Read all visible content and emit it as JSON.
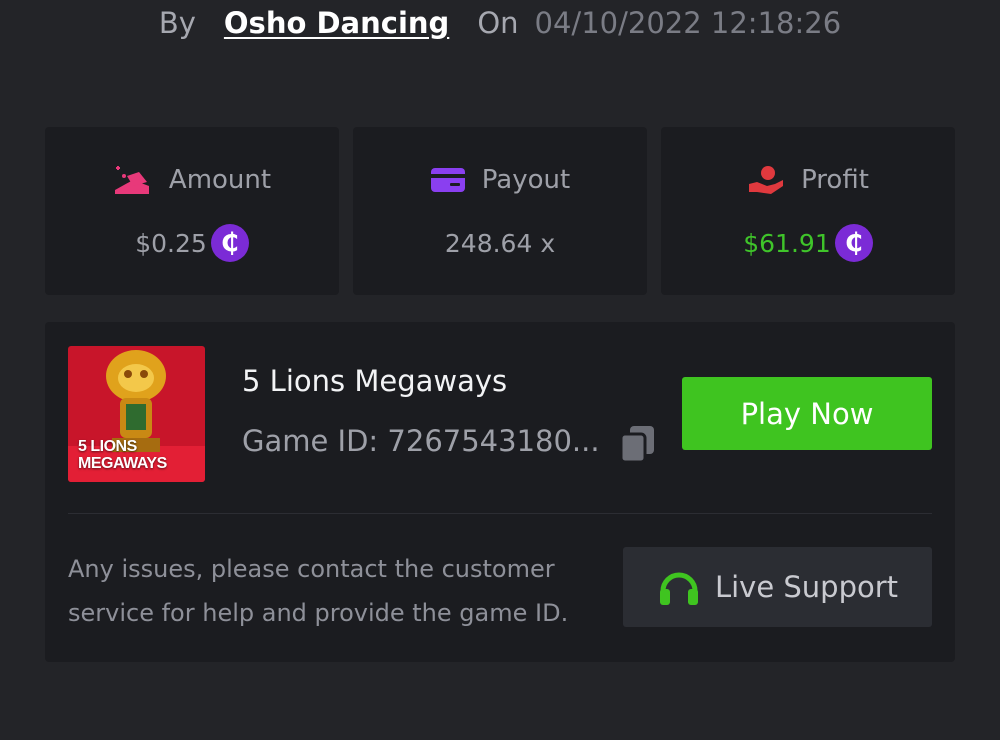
{
  "byline": {
    "by_label": "By",
    "username": "Osho Dancing",
    "on_label": "On",
    "datetime": "04/10/2022 12:18:26"
  },
  "stats": {
    "amount": {
      "label": "Amount",
      "value": "$0.25",
      "icon": "bet-chips-icon",
      "icon_color": "#e8397a"
    },
    "payout": {
      "label": "Payout",
      "value": "248.64 x",
      "icon": "wallet-card-icon",
      "icon_color": "#8a3ff0"
    },
    "profit": {
      "label": "Profit",
      "value": "$61.91",
      "icon": "hand-coin-icon",
      "icon_color": "#e0393e",
      "value_color": "#3fc42a"
    }
  },
  "coin_symbol": "₵",
  "game": {
    "thumbnail_text_line1": "5 LIONS",
    "thumbnail_text_line2": "MEGAWAYS",
    "name": "5 Lions Megaways",
    "game_id": "Game ID: 7267543180...",
    "play_label": "Play Now"
  },
  "support": {
    "help_text": "Any issues, please contact the customer service for help and provide the game ID.",
    "button_label": "Live Support"
  },
  "colors": {
    "background": "#232428",
    "card": "#1b1c20",
    "accent_green": "#3fc420",
    "coin_purple": "#7b2bd6"
  }
}
